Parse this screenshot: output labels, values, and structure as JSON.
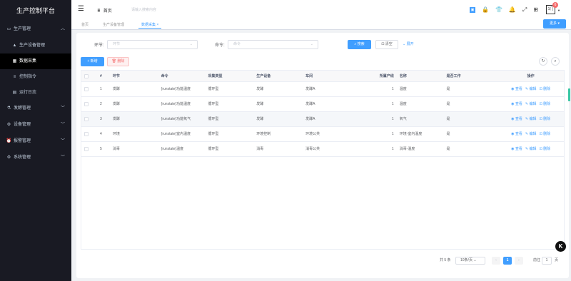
{
  "app": {
    "title": "生产控制平台"
  },
  "sidebar": {
    "groups": [
      {
        "label": "生产管理",
        "icon": "folder-icon",
        "expanded": true,
        "items": [
          {
            "label": "生产设备管理",
            "icon": "device-icon"
          },
          {
            "label": "数据采集",
            "icon": "data-icon",
            "active": true
          },
          {
            "label": "控制指令",
            "icon": "command-icon"
          },
          {
            "label": "运行日志",
            "icon": "log-icon"
          }
        ]
      },
      {
        "label": "发酵管理",
        "icon": "flask-icon"
      },
      {
        "label": "设备管理",
        "icon": "gear-icon"
      },
      {
        "label": "报警管理",
        "icon": "alarm-icon"
      },
      {
        "label": "系统管理",
        "icon": "settings-icon"
      }
    ]
  },
  "navbar": {
    "breadcrumb": "首页",
    "search_placeholder": "请输入搜索内容",
    "avatar_text": "1门",
    "badge": "6"
  },
  "tags": {
    "items": [
      "首页",
      "生产设备管理",
      "数据采集"
    ],
    "active_index": 2,
    "close": "×",
    "more": "更多"
  },
  "filters": {
    "huanjie_label": "环节:",
    "huanjie_placeholder": "环节",
    "command_label": "命令:",
    "command_placeholder": "命令",
    "search_btn": "搜索",
    "reset_btn": "清空",
    "expand_btn": "展开"
  },
  "toolbar": {
    "add_btn": "新增",
    "delete_btn": "删除"
  },
  "table": {
    "headers": [
      "#",
      "环节",
      "命令",
      "采集类型",
      "生产设备",
      "车间",
      "所属产线",
      "名称",
      "是否工作",
      "操作"
    ],
    "rows": [
      {
        "idx": "1",
        "huanjie": "发酵",
        "command": "{runstate}功能温度",
        "type": "循环型",
        "device": "发酵",
        "workshop": "发酵A",
        "line": "1",
        "name": "温度",
        "working": "是"
      },
      {
        "idx": "2",
        "huanjie": "发酵",
        "command": "{runstate}功能温度",
        "type": "循环型",
        "device": "发酵",
        "workshop": "发酵A",
        "line": "1",
        "name": "温度",
        "working": "是"
      },
      {
        "idx": "3",
        "huanjie": "发酵",
        "command": "{runstate}功能氧气",
        "type": "循环型",
        "device": "发酵",
        "workshop": "发酵A",
        "line": "1",
        "name": "氧气",
        "working": "是"
      },
      {
        "idx": "4",
        "huanjie": "环境",
        "command": "{runstate}室内温度",
        "type": "循环型",
        "device": "环境控制",
        "workshop": "环境公共",
        "line": "1",
        "name": "环境-室内温度",
        "working": "是"
      },
      {
        "idx": "5",
        "huanjie": "消毒",
        "command": "{runstate}温度",
        "type": "循环型",
        "device": "消毒",
        "workshop": "消毒公共",
        "line": "1",
        "name": "消毒-温度",
        "working": "是"
      }
    ],
    "ops": {
      "view": "查看",
      "edit": "编辑",
      "delete": "删除"
    }
  },
  "pagination": {
    "total": "共 5 条",
    "page_size": "10条/页",
    "current": "1",
    "goto_label": "前往",
    "goto_value": "1",
    "page_suffix": "页"
  },
  "float_button": "K",
  "colors": {
    "primary": "#409eff",
    "danger": "#f56c6c",
    "sidebar_bg": "#191a23"
  }
}
